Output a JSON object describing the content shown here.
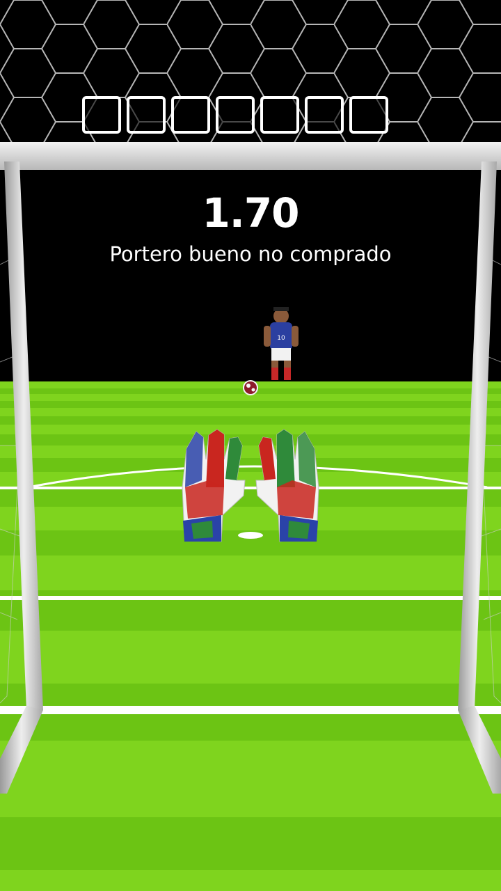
{
  "hud": {
    "score": "1.70",
    "caption": "Portero bueno no comprado",
    "shots_total": 7,
    "shots_filled": 0
  },
  "colors": {
    "sky": "#000000",
    "grass_light": "#7cd21a",
    "grass_dark": "#5cb50c",
    "goal_post": "#d8d8d8",
    "glove_red": "#c9261f",
    "glove_green": "#2f8a3a",
    "glove_blue": "#2a43a8",
    "kicker_shirt": "#2b3fa0"
  },
  "icons": {
    "ball": "soccer-ball-icon",
    "gloves": "goalkeeper-gloves-icon",
    "kicker": "player-figure-icon"
  }
}
